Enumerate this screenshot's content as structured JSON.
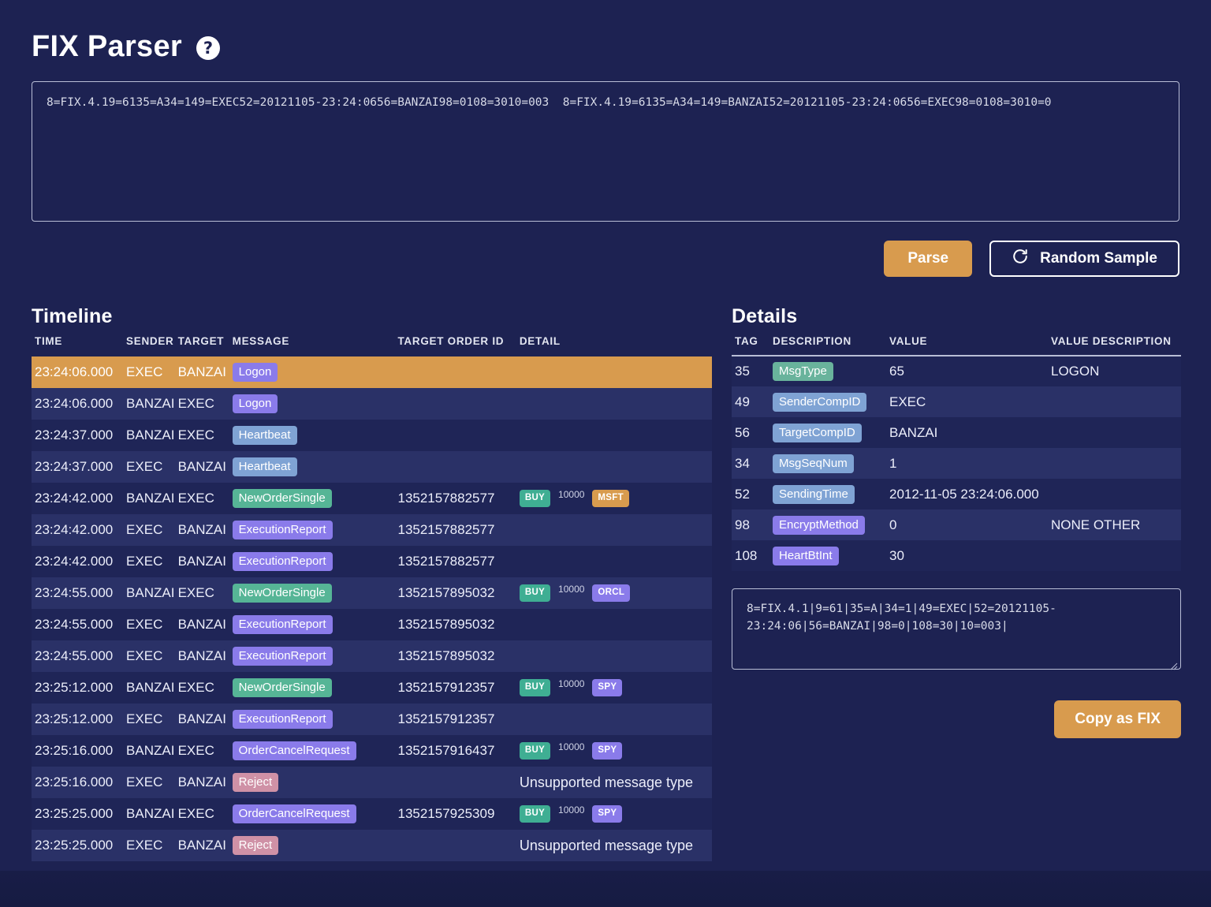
{
  "header": {
    "title": "FIX Parser",
    "help_icon": "question-mark-circle-icon"
  },
  "input": {
    "value": "8=FIX.4.19=6135=A34=149=EXEC52=20121105-23:24:0656=BANZAI98=0108=3010=003  8=FIX.4.19=6135=A34=149=BANZAI52=20121105-23:24:0656=EXEC98=0108=3010=0",
    "placeholder": ""
  },
  "toolbar": {
    "parse_label": "Parse",
    "random_sample_label": "Random Sample",
    "refresh_icon": "refresh-icon"
  },
  "timeline": {
    "heading": "Timeline",
    "columns": [
      "TIME",
      "SENDER",
      "TARGET",
      "MESSAGE",
      "TARGET ORDER ID",
      "DETAIL"
    ],
    "rows": [
      {
        "time": "23:24:06.000",
        "sender": "EXEC",
        "target": "BANZAI",
        "message": "Logon",
        "message_color": "#8a7bea",
        "order_id": "",
        "side": "",
        "qty": "",
        "symbol": "",
        "symbol_color": "",
        "detail_text": "",
        "selected": true
      },
      {
        "time": "23:24:06.000",
        "sender": "BANZAI",
        "target": "EXEC",
        "message": "Logon",
        "message_color": "#8a7bea",
        "order_id": "",
        "side": "",
        "qty": "",
        "symbol": "",
        "symbol_color": "",
        "detail_text": "",
        "selected": false
      },
      {
        "time": "23:24:37.000",
        "sender": "BANZAI",
        "target": "EXEC",
        "message": "Heartbeat",
        "message_color": "#7fa3d4",
        "order_id": "",
        "side": "",
        "qty": "",
        "symbol": "",
        "symbol_color": "",
        "detail_text": "",
        "selected": false
      },
      {
        "time": "23:24:37.000",
        "sender": "EXEC",
        "target": "BANZAI",
        "message": "Heartbeat",
        "message_color": "#7fa3d4",
        "order_id": "",
        "side": "",
        "qty": "",
        "symbol": "",
        "symbol_color": "",
        "detail_text": "",
        "selected": false
      },
      {
        "time": "23:24:42.000",
        "sender": "BANZAI",
        "target": "EXEC",
        "message": "NewOrderSingle",
        "message_color": "#56b596",
        "order_id": "1352157882577",
        "side": "BUY",
        "qty": "10000",
        "symbol": "MSFT",
        "symbol_color": "#d89b4e",
        "detail_text": "",
        "selected": false
      },
      {
        "time": "23:24:42.000",
        "sender": "EXEC",
        "target": "BANZAI",
        "message": "ExecutionReport",
        "message_color": "#8a7bea",
        "order_id": "1352157882577",
        "side": "",
        "qty": "",
        "symbol": "",
        "symbol_color": "",
        "detail_text": "",
        "selected": false
      },
      {
        "time": "23:24:42.000",
        "sender": "EXEC",
        "target": "BANZAI",
        "message": "ExecutionReport",
        "message_color": "#8a7bea",
        "order_id": "1352157882577",
        "side": "",
        "qty": "",
        "symbol": "",
        "symbol_color": "",
        "detail_text": "",
        "selected": false
      },
      {
        "time": "23:24:55.000",
        "sender": "BANZAI",
        "target": "EXEC",
        "message": "NewOrderSingle",
        "message_color": "#56b596",
        "order_id": "1352157895032",
        "side": "BUY",
        "qty": "10000",
        "symbol": "ORCL",
        "symbol_color": "#8a7bea",
        "detail_text": "",
        "selected": false
      },
      {
        "time": "23:24:55.000",
        "sender": "EXEC",
        "target": "BANZAI",
        "message": "ExecutionReport",
        "message_color": "#8a7bea",
        "order_id": "1352157895032",
        "side": "",
        "qty": "",
        "symbol": "",
        "symbol_color": "",
        "detail_text": "",
        "selected": false
      },
      {
        "time": "23:24:55.000",
        "sender": "EXEC",
        "target": "BANZAI",
        "message": "ExecutionReport",
        "message_color": "#8a7bea",
        "order_id": "1352157895032",
        "side": "",
        "qty": "",
        "symbol": "",
        "symbol_color": "",
        "detail_text": "",
        "selected": false
      },
      {
        "time": "23:25:12.000",
        "sender": "BANZAI",
        "target": "EXEC",
        "message": "NewOrderSingle",
        "message_color": "#56b596",
        "order_id": "1352157912357",
        "side": "BUY",
        "qty": "10000",
        "symbol": "SPY",
        "symbol_color": "#8a7bea",
        "detail_text": "",
        "selected": false
      },
      {
        "time": "23:25:12.000",
        "sender": "EXEC",
        "target": "BANZAI",
        "message": "ExecutionReport",
        "message_color": "#8a7bea",
        "order_id": "1352157912357",
        "side": "",
        "qty": "",
        "symbol": "",
        "symbol_color": "",
        "detail_text": "",
        "selected": false
      },
      {
        "time": "23:25:16.000",
        "sender": "BANZAI",
        "target": "EXEC",
        "message": "OrderCancelRequest",
        "message_color": "#8a7bea",
        "order_id": "1352157916437",
        "side": "BUY",
        "qty": "10000",
        "symbol": "SPY",
        "symbol_color": "#8a7bea",
        "detail_text": "",
        "selected": false
      },
      {
        "time": "23:25:16.000",
        "sender": "EXEC",
        "target": "BANZAI",
        "message": "Reject",
        "message_color": "#cf91a6",
        "order_id": "",
        "side": "",
        "qty": "",
        "symbol": "",
        "symbol_color": "",
        "detail_text": "Unsupported message type",
        "selected": false
      },
      {
        "time": "23:25:25.000",
        "sender": "BANZAI",
        "target": "EXEC",
        "message": "OrderCancelRequest",
        "message_color": "#8a7bea",
        "order_id": "1352157925309",
        "side": "BUY",
        "qty": "10000",
        "symbol": "SPY",
        "symbol_color": "#8a7bea",
        "detail_text": "",
        "selected": false
      },
      {
        "time": "23:25:25.000",
        "sender": "EXEC",
        "target": "BANZAI",
        "message": "Reject",
        "message_color": "#cf91a6",
        "order_id": "",
        "side": "",
        "qty": "",
        "symbol": "",
        "symbol_color": "",
        "detail_text": "Unsupported message type",
        "selected": false
      }
    ],
    "side_badge_color": "#3fae93"
  },
  "details": {
    "heading": "Details",
    "columns": [
      "TAG",
      "DESCRIPTION",
      "VALUE",
      "VALUE DESCRIPTION"
    ],
    "rows": [
      {
        "tag": "35",
        "description": "MsgType",
        "desc_color": "#69b39c",
        "value": "65",
        "value_description": "LOGON"
      },
      {
        "tag": "49",
        "description": "SenderCompID",
        "desc_color": "#7fa3d4",
        "value": "EXEC",
        "value_description": ""
      },
      {
        "tag": "56",
        "description": "TargetCompID",
        "desc_color": "#7fa3d4",
        "value": "BANZAI",
        "value_description": ""
      },
      {
        "tag": "34",
        "description": "MsgSeqNum",
        "desc_color": "#7fa3d4",
        "value": "1",
        "value_description": ""
      },
      {
        "tag": "52",
        "description": "SendingTime",
        "desc_color": "#7fa3d4",
        "value": "2012-11-05 23:24:06.000",
        "value_description": ""
      },
      {
        "tag": "98",
        "description": "EncryptMethod",
        "desc_color": "#8a7bea",
        "value": "0",
        "value_description": "NONE OTHER"
      },
      {
        "tag": "108",
        "description": "HeartBtInt",
        "desc_color": "#8a7bea",
        "value": "30",
        "value_description": ""
      }
    ],
    "raw_message": "8=FIX.4.1|9=61|35=A|34=1|49=EXEC|52=20121105-\n23:24:06|56=BANZAI|98=0|108=30|10=003|",
    "copy_label": "Copy as FIX"
  },
  "colors": {
    "background": "#1d2252",
    "accent": "#d89b4e",
    "row": "#1f2557",
    "row_alt": "#2a3167",
    "selected_row": "#d89b4e"
  }
}
